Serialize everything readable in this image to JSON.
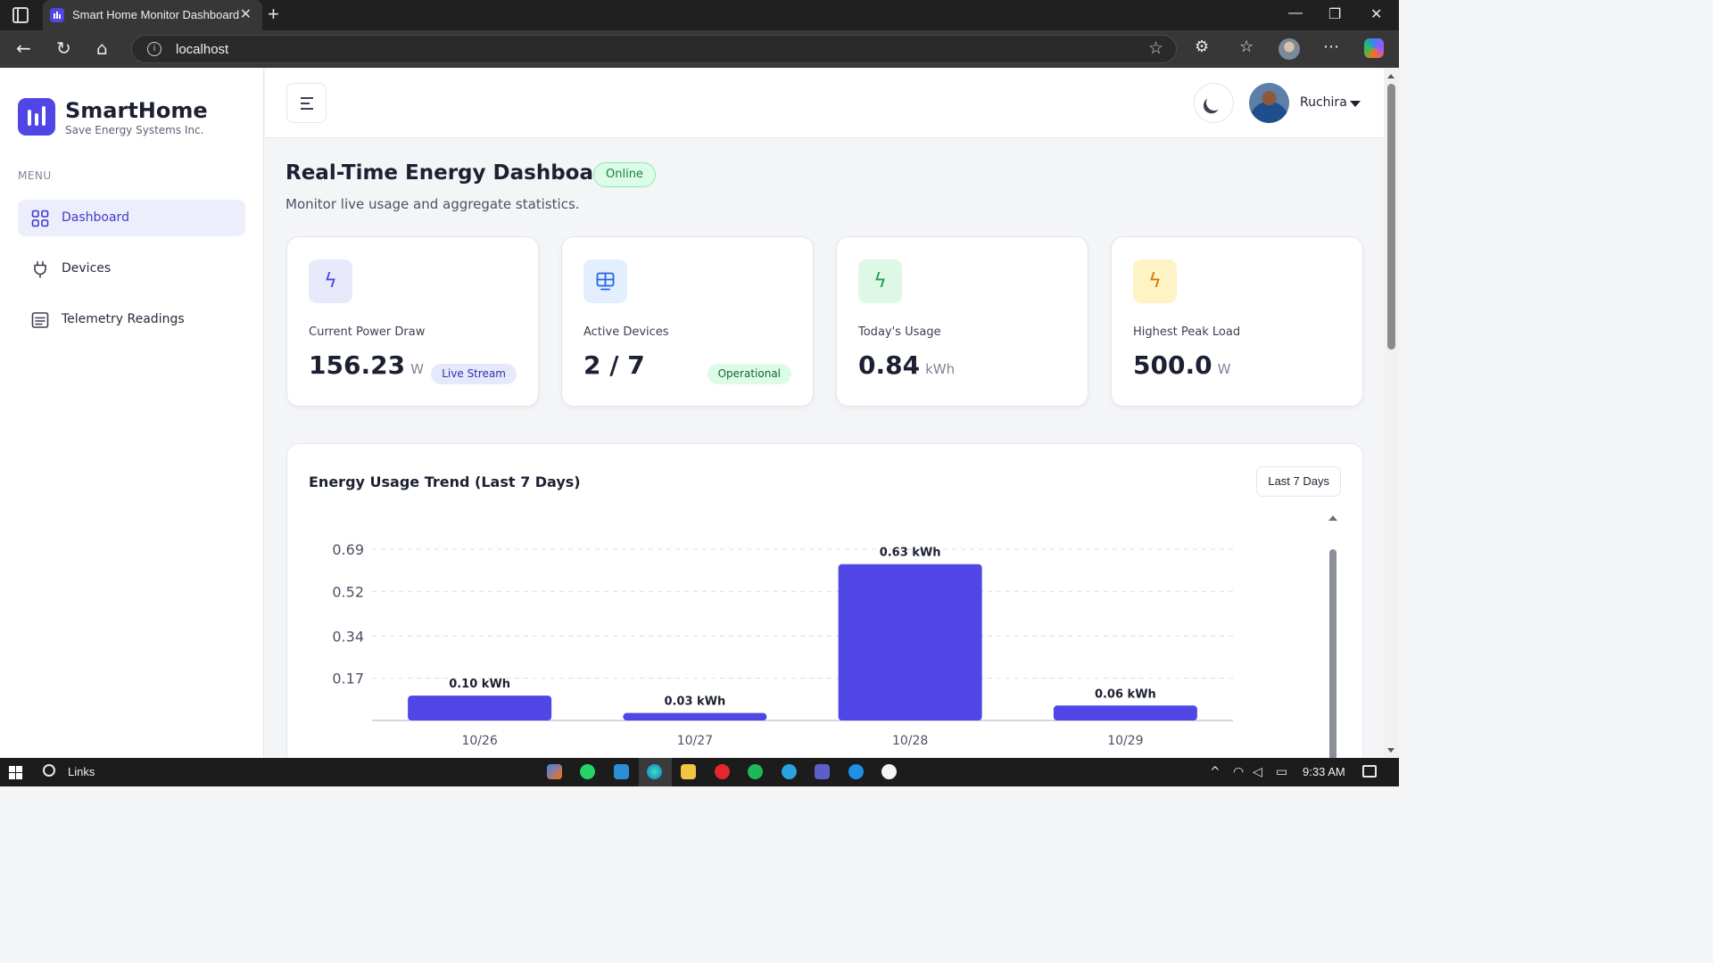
{
  "browser": {
    "tab_title": "Smart Home Monitor Dashboard",
    "tab_close": "✕",
    "new_tab": "+",
    "url": "localhost",
    "win_min": "—",
    "win_max": "❐",
    "win_close": "✕"
  },
  "sidebar": {
    "brand_name": "SmartHome",
    "brand_sub": "Save Energy Systems Inc.",
    "menu_label": "MENU",
    "items": [
      {
        "label": "Dashboard",
        "icon": "grid-icon",
        "active": true
      },
      {
        "label": "Devices",
        "icon": "plug-icon",
        "active": false
      },
      {
        "label": "Telemetry Readings",
        "icon": "list-icon",
        "active": false
      }
    ]
  },
  "header": {
    "user_name": "Ruchira"
  },
  "page": {
    "title": "Real-Time Energy Dashboard",
    "status": "Online",
    "subtitle": "Monitor live usage and aggregate statistics."
  },
  "cards": [
    {
      "label": "Current Power Draw",
      "value": "156.23",
      "unit": "W",
      "badge": "Live Stream",
      "icon": "bolt-icon",
      "accent": "#4f46e5",
      "tile": "#e8e9fb",
      "badge_bg": "#e6e8fb",
      "badge_fg": "#3730a3"
    },
    {
      "label": "Active Devices",
      "value": "2 / 7",
      "unit": "",
      "badge": "Operational",
      "icon": "devices-icon",
      "accent": "#2563eb",
      "tile": "#e3eefe",
      "badge_bg": "#dcfce7",
      "badge_fg": "#166534"
    },
    {
      "label": "Today's Usage",
      "value": "0.84",
      "unit": "kWh",
      "badge": "",
      "icon": "bolt-icon",
      "accent": "#16a34a",
      "tile": "#dff7e7",
      "badge_bg": "",
      "badge_fg": ""
    },
    {
      "label": "Highest Peak Load",
      "value": "500.0",
      "unit": "W",
      "badge": "",
      "icon": "bolt-icon",
      "accent": "#d97706",
      "tile": "#fdf3c4",
      "badge_bg": "",
      "badge_fg": ""
    }
  ],
  "chart": {
    "title": "Energy Usage Trend (Last 7 Days)",
    "range_button": "Last 7 Days"
  },
  "chart_data": {
    "type": "bar",
    "categories": [
      "10/26",
      "10/27",
      "10/28",
      "10/29"
    ],
    "values": [
      0.1,
      0.03,
      0.63,
      0.06
    ],
    "data_labels": [
      "0.10 kWh",
      "0.03 kWh",
      "0.63 kWh",
      "0.06 kWh"
    ],
    "y_ticks": [
      "0.17",
      "0.34",
      "0.52",
      "0.69"
    ],
    "y_tick_values": [
      0.17,
      0.34,
      0.52,
      0.69
    ],
    "ylim": [
      0,
      0.69
    ],
    "grid": true,
    "bar_color": "#4f46e5"
  },
  "taskbar": {
    "links_label": "Links",
    "time": "9:33 AM"
  }
}
